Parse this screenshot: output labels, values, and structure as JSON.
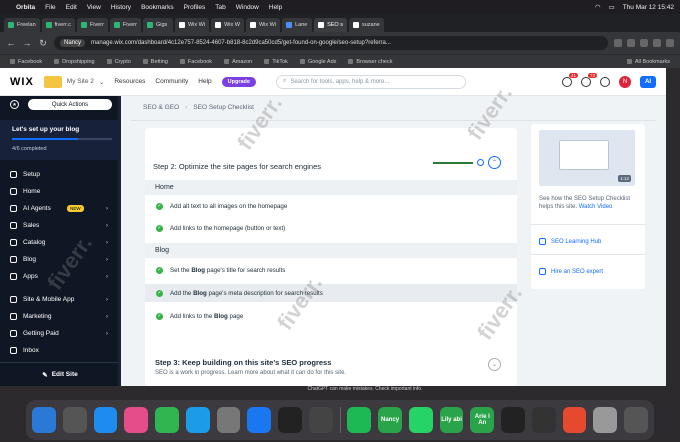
{
  "macbar": {
    "app": "Orbita",
    "menus": [
      "File",
      "Edit",
      "View",
      "History",
      "Bookmarks",
      "Profiles",
      "Tab",
      "Window",
      "Help"
    ],
    "clock": "Thu Mar 12  15:42"
  },
  "tabs": [
    "Freelan",
    "fiverr.c",
    "Fiverr",
    "Fiverr",
    "Gigs",
    "Wix Wi",
    "Wix W",
    "Wix Wi",
    "Lane",
    "SEO s",
    "suzane"
  ],
  "address": {
    "profile": "Nancy",
    "url": "manage.wix.com/dashboard/4c12e757-8524-4607-b818-8c2d9ca50cd5/get-found-on-google/seo-setup?referra..."
  },
  "bookmarks": [
    "Facebook",
    "Dropshipping",
    "Crypto",
    "Betting",
    "Facebook",
    "Amazon",
    "TikTok",
    "Google Ads",
    "Browser check"
  ],
  "bookmarks_all": "All Bookmarks",
  "wix": {
    "logo": "WIX",
    "site": "My Site 2",
    "menus": [
      "Resources",
      "Community",
      "Help"
    ],
    "upgrade": "Upgrade",
    "search_placeholder": "Search for tools, apps, help & more...",
    "notif_count": "41",
    "msg_count": "73",
    "avatar": "N",
    "ai": "AI"
  },
  "sidebar": {
    "quick_actions": "Quick Actions",
    "setup_title": "Let's set up your blog",
    "progress_value": 0.66,
    "completed": "4/6 completed",
    "items": [
      {
        "label": "Setup"
      },
      {
        "label": "Home"
      },
      {
        "label": "AI Agents",
        "badge": "NEW"
      },
      {
        "label": "Sales"
      },
      {
        "label": "Catalog"
      },
      {
        "label": "Blog"
      },
      {
        "label": "Apps"
      }
    ],
    "items2": [
      {
        "label": "Site & Mobile App"
      },
      {
        "label": "Marketing"
      },
      {
        "label": "Getting Paid"
      },
      {
        "label": "Inbox"
      }
    ],
    "edit_site": "Edit Site"
  },
  "breadcrumb": {
    "first": "SEO & GEO",
    "second": "SEO Setup Checklist"
  },
  "step2": {
    "title": "Step 2: Optimize the site pages for search engines",
    "home": "Home",
    "home_items": [
      "Add alt text to all images on the homepage",
      "Add links to the homepage (button or text)"
    ],
    "blog": "Blog",
    "blog_items": [
      [
        "Set the ",
        "Blog",
        " page's title for search results"
      ],
      [
        "Add the ",
        "Blog",
        " page's meta description for search results"
      ],
      [
        "Add links to the ",
        "Blog",
        " page"
      ]
    ]
  },
  "step3": {
    "title": "Step 3: Keep building on this site's SEO progress",
    "subtitle": "SEO is a work in progress. Learn more about what it can do for this site."
  },
  "right": {
    "video_time": "1:12",
    "desc": "See how the SEO Setup Checklist helps this site.",
    "watch": "Watch Video",
    "learning": "SEO Learning Hub",
    "hire": "Hire an SEO expert"
  },
  "footer_note": "ChatGPT can make mistakes. Check important info.",
  "dock": [
    "Nancy",
    "Lily abi",
    "Arie l An"
  ],
  "watermark": "fiverr."
}
